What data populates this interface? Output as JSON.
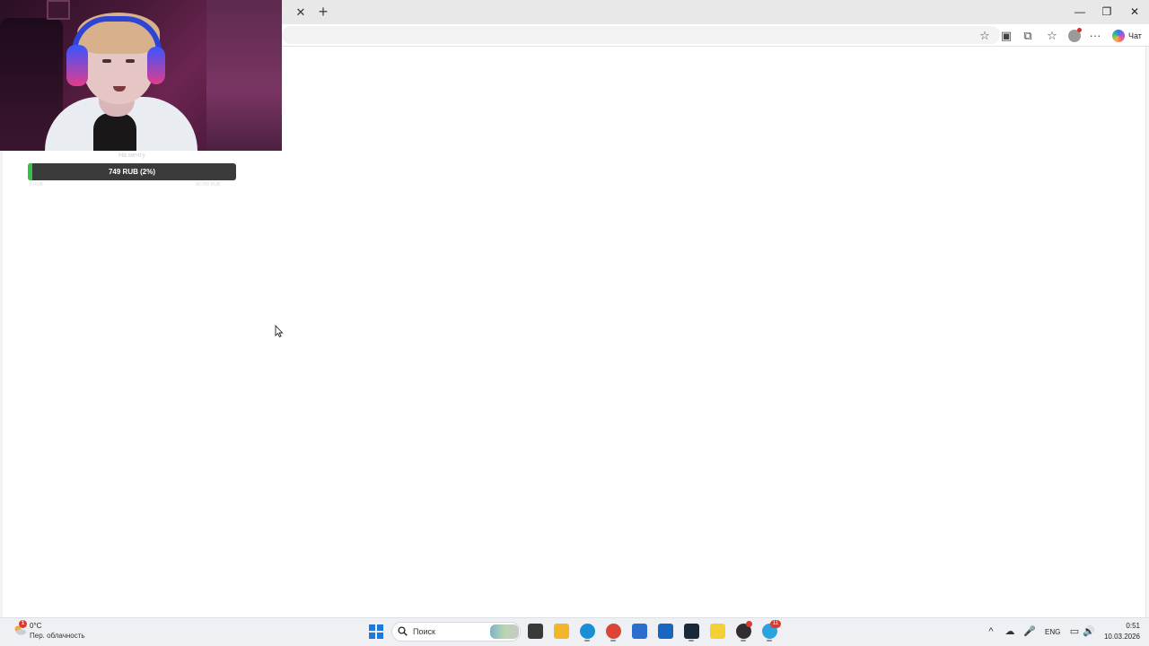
{
  "browser": {
    "tab_close_glyph": "✕",
    "new_tab_glyph": "+",
    "window_controls": {
      "minimize": "—",
      "maximize": "❐",
      "close": "✕"
    },
    "toolbar_icons": [
      "star-icon",
      "screenshot-icon",
      "extensions-icon",
      "favorites-icon",
      "profile-icon",
      "more-icon",
      "copilot-icon"
    ],
    "more_glyph": "···",
    "star_glyph": "☆",
    "favorites_glyph": "☆",
    "extensions_glyph": "⧉",
    "screenshot_glyph": "▣",
    "chat_label": "Чат"
  },
  "donation_goal": {
    "title": "На мечту",
    "progress_label": "749 RUB (2%)",
    "progress_fraction": 0.02,
    "min_label": "0 RUB",
    "max_label": "40 000 RUB",
    "fill_color": "#35c24a",
    "bar_color": "#3b3b3b"
  },
  "taskbar": {
    "weather": {
      "temp": "0°C",
      "desc": "Пер. облачность",
      "badge": "1"
    },
    "search_placeholder": "Поиск",
    "apps": [
      {
        "name": "file-manager-app-icon",
        "color": "#3a3a3a"
      },
      {
        "name": "folder-app-icon",
        "color": "#f2b62a"
      },
      {
        "name": "edge-app-icon",
        "color": "#1a8fd6"
      },
      {
        "name": "chrome-app-icon",
        "color": "#db4437"
      },
      {
        "name": "store-app-icon",
        "color": "#2a6fd0"
      },
      {
        "name": "outlook-app-icon",
        "color": "#1766c2"
      },
      {
        "name": "steam-app-icon",
        "color": "#1b2838"
      },
      {
        "name": "game-app-icon",
        "color": "#f5d033"
      },
      {
        "name": "obs-app-icon",
        "color": "#302e31"
      },
      {
        "name": "telegram-app-icon",
        "color": "#2aa3df"
      }
    ],
    "telegram_badge": "11",
    "tray": {
      "chevron_glyph": "^",
      "language": "ENG",
      "time": "0:51",
      "date": "10.03.2026"
    }
  }
}
